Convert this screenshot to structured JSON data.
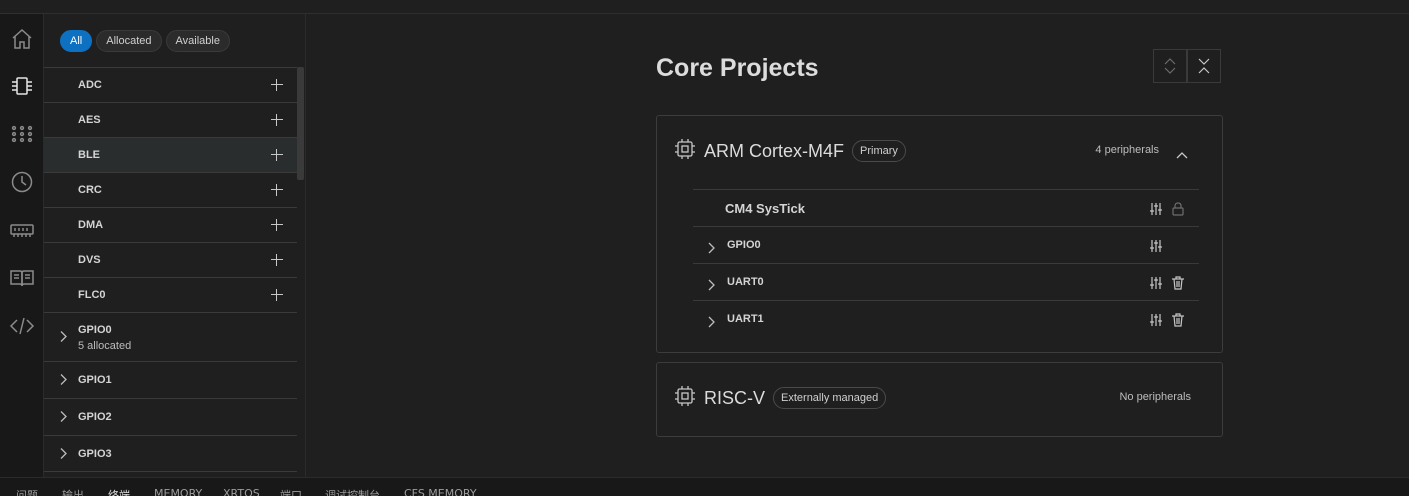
{
  "activity_bar": {
    "icons": [
      "home-icon",
      "chip-icon",
      "grid-dots-icon",
      "clock-icon",
      "memory-icon",
      "book-icon",
      "code-icon"
    ],
    "active": "chip-icon"
  },
  "sidebar": {
    "filters": [
      {
        "label": "All",
        "active": true
      },
      {
        "label": "Allocated",
        "active": false
      },
      {
        "label": "Available",
        "active": false
      }
    ],
    "peripherals": [
      {
        "name": "ADC",
        "action": "plus-icon"
      },
      {
        "name": "AES",
        "action": "plus-icon"
      },
      {
        "name": "BLE",
        "action": "plus-icon",
        "selected": true
      },
      {
        "name": "CRC",
        "action": "plus-icon"
      },
      {
        "name": "DMA",
        "action": "plus-icon"
      },
      {
        "name": "DVS",
        "action": "plus-icon"
      },
      {
        "name": "FLC0",
        "action": "plus-icon"
      },
      {
        "name": "GPIO0",
        "sub": "5 allocated",
        "expandable": true
      },
      {
        "name": "GPIO1",
        "expandable": true
      },
      {
        "name": "GPIO2",
        "expandable": true
      },
      {
        "name": "GPIO3",
        "expandable": true
      }
    ]
  },
  "main": {
    "title": "Core Projects",
    "cores": [
      {
        "name": "ARM Cortex-M4F",
        "badge": "Primary",
        "count_label": "4 peripherals",
        "expanded": true,
        "peripherals": [
          {
            "name": "CM4 SysTick",
            "locked": true
          },
          {
            "name": "GPIO0",
            "deletable": false
          },
          {
            "name": "UART0",
            "deletable": true
          },
          {
            "name": "UART1",
            "deletable": true
          }
        ]
      },
      {
        "name": "RISC-V",
        "badge": "Externally managed",
        "count_label": "No peripherals"
      }
    ]
  },
  "bottom_panel": {
    "tabs": [
      "问题",
      "输出",
      "终端",
      "MEMORY",
      "XRTOS",
      "端口",
      "调试控制台",
      "CFS MEMORY"
    ],
    "active": "终端"
  },
  "colors": {
    "accent": "#0e70c0",
    "background": "#1f1f1f",
    "activity_bar": "#181818"
  }
}
